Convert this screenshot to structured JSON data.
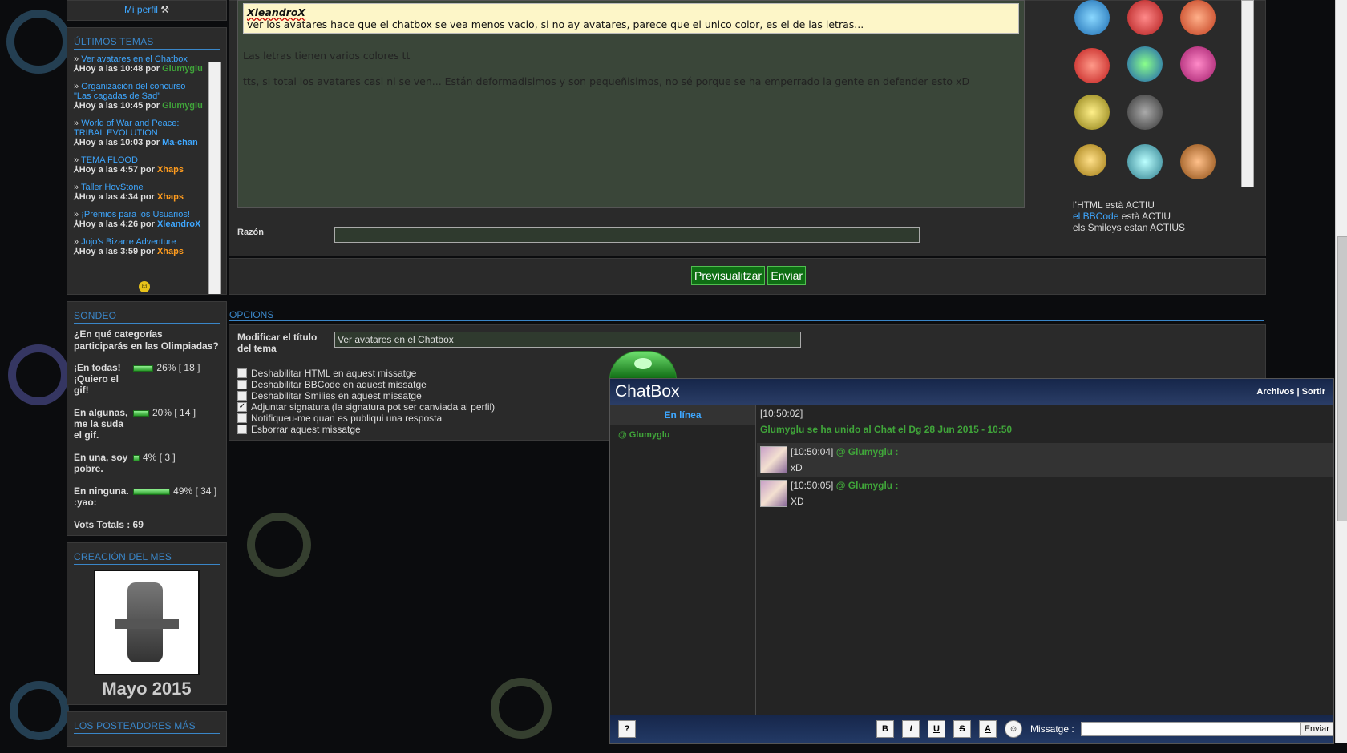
{
  "sidebar": {
    "profile_link": "Mi perfil",
    "latest_topics": {
      "title": "ÚLTIMOS TEMAS",
      "items": [
        {
          "title": "Ver avatares en el Chatbox",
          "meta": "Hoy a las 10:48 por",
          "user": "Glumyglu",
          "user_color": "green"
        },
        {
          "title": "Organización del concurso \"Las cagadas de Sad\"",
          "meta": "Hoy a las 10:45 por",
          "user": "Glumyglu",
          "user_color": "green"
        },
        {
          "title": "World of War and Peace: TRIBAL EVOLUTION",
          "meta": "Hoy a las 10:03 por",
          "user": "Ma-chan",
          "user_color": "blue"
        },
        {
          "title": "TEMA FLOOD",
          "meta": "Hoy a las 4:57 por",
          "user": "Xhaps",
          "user_color": "orange"
        },
        {
          "title": "Taller HovStone",
          "meta": "Hoy a las 4:34 por",
          "user": "Xhaps",
          "user_color": "orange"
        },
        {
          "title": "¡Premios para los Usuarios!",
          "meta": "Hoy a las 4:26 por",
          "user": "XleandroX",
          "user_color": "blue"
        },
        {
          "title": "Jojo's Bizarre Adventure",
          "meta": "Hoy a las 3:59 por",
          "user": "Xhaps",
          "user_color": "orange"
        }
      ]
    },
    "poll": {
      "title": "SONDEO",
      "question": "¿En qué categorías participarás en las Olimpiadas?",
      "options": [
        {
          "label": "¡En todas! ¡Quiero el gif!",
          "percent": 26,
          "pct_text": "26%",
          "votes_text": "[ 18 ]"
        },
        {
          "label": "En algunas, me la suda el gif.",
          "percent": 20,
          "pct_text": "20%",
          "votes_text": "[ 14 ]"
        },
        {
          "label": "En una, soy pobre.",
          "percent": 4,
          "pct_text": "4%",
          "votes_text": "[ 3 ]"
        },
        {
          "label": "En ninguna. :yao:",
          "percent": 49,
          "pct_text": "49%",
          "votes_text": "[ 34 ]"
        }
      ],
      "total": "Vots Totals : 69"
    },
    "creation": {
      "title": "CREACIÓN DEL MES",
      "caption": "Mayo 2015"
    },
    "next_title": "LOS POSTEADORES MÁS"
  },
  "editor": {
    "quote_author": "XleandroX",
    "quote_text": "ver los avatares hace que el chatbox se vea menos vacio, si no ay avatares, parece que el unico color, es el de las letras...",
    "line1": "Las letras tienen varios colores tt",
    "line2": "tts, si total los avatares casi ni se ven... Están deformadisimos y son pequeñisimos, no sé porque se ha emperrado la gente en defender esto xD"
  },
  "status": {
    "html": "l'HTML està ACTIU",
    "bbcode_link": "el BBCode",
    "bbcode_rest": " està ACTIU",
    "smileys": "els Smileys estan ACTIUS"
  },
  "reason": {
    "label": "Razón"
  },
  "actions": {
    "preview": "Previsualitzar",
    "send": "Enviar"
  },
  "options": {
    "title": "OPCIONS",
    "modify_title_label": "Modificar el título del tema",
    "title_value": "Ver avatares en el Chatbox",
    "checkboxes": [
      {
        "label": "Deshabilitar HTML en aquest missatge",
        "checked": false
      },
      {
        "label": "Deshabilitar BBCode en aquest missatge",
        "checked": false
      },
      {
        "label": "Deshabilitar Smilies en aquest missatge",
        "checked": false
      },
      {
        "label": "Adjuntar signatura (la signatura pot ser canviada al perfil)",
        "checked": true
      },
      {
        "label": "Notifiqueu-me quan es publiqui una resposta",
        "checked": false
      },
      {
        "label": "Esborrar aquest missatge",
        "checked": false
      }
    ]
  },
  "chatbox": {
    "title": "ChatBox",
    "archive": "Archivos",
    "sep": "|",
    "exit": "Sortir",
    "online_label": "En línea",
    "online_user": "@ Glumyglu",
    "system_time": "[10:50:02]",
    "system_msg": "Glumyglu se ha unido al Chat el Dg 28 Jun 2015 - 10:50",
    "messages": [
      {
        "time": "[10:50:04]",
        "user": "@ Glumyglu :",
        "text": "xD"
      },
      {
        "time": "[10:50:05]",
        "user": "@ Glumyglu :",
        "text": "XD"
      }
    ],
    "footer": {
      "help": "?",
      "bold": "B",
      "italic": "I",
      "underline": "U",
      "strike": "S",
      "color": "A",
      "message_label": "Missatge :",
      "send": "Enviar"
    }
  },
  "colors": {
    "accent": "#3ea7ff",
    "green_user": "#40a53a",
    "orange_user": "#ff9c1e",
    "chat_header": "#1b2c52"
  }
}
